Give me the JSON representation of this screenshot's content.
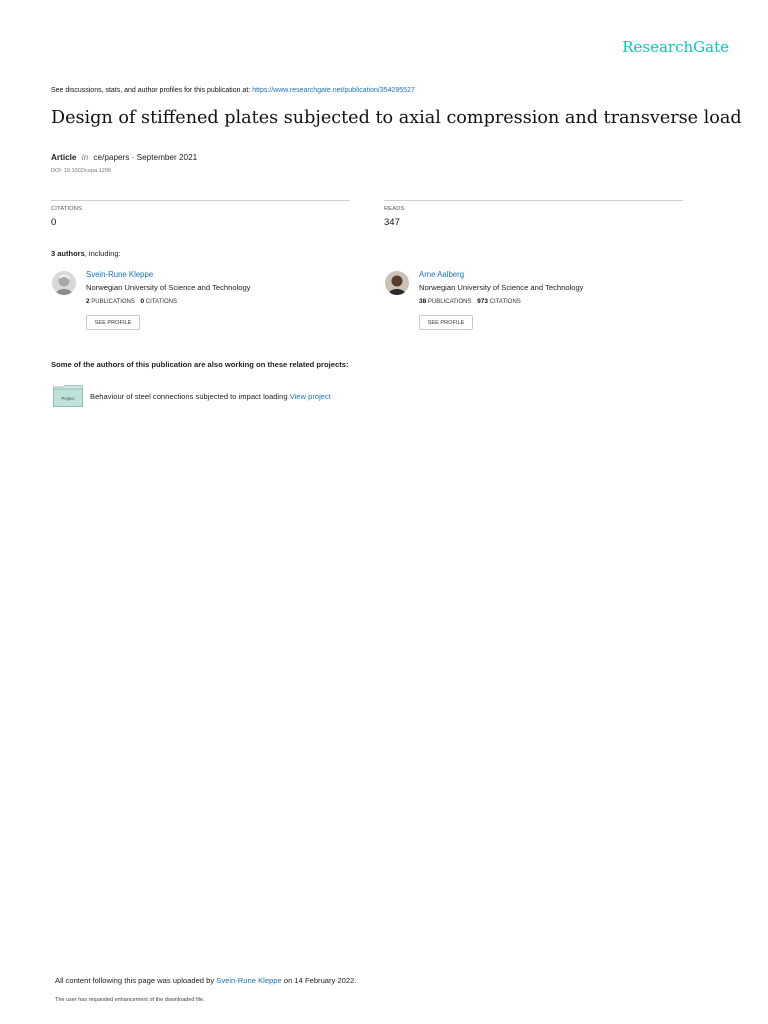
{
  "brand": {
    "name": "ResearchGate",
    "color": "#00ccbb"
  },
  "discussion": {
    "prefix": "See discussions, stats, and author profiles for this publication at:",
    "url": "https://www.researchgate.net/publication/354295527"
  },
  "title": "Design of stiffened plates subjected to axial compression and transverse load",
  "meta": {
    "type": "Article",
    "in_word": "in",
    "venue": "ce/papers",
    "date": " · September 2021",
    "doi": "DOI: 10.1002/cepa.1299"
  },
  "stats": {
    "citations_label": "CITATIONS",
    "citations_value": "0",
    "reads_label": "READS",
    "reads_value": "347"
  },
  "authors_heading": {
    "count": "3 authors",
    "suffix": ", including:"
  },
  "authors": [
    {
      "name": "Svein-Rune Kleppe",
      "affiliation": "Norwegian University of Science and Technology",
      "publications": "2",
      "publications_label": "PUBLICATIONS",
      "citations": "0",
      "citations_label": "CITATIONS",
      "button": "SEE PROFILE"
    },
    {
      "name": "Arne Aalberg",
      "affiliation": "Norwegian University of Science and Technology",
      "publications": "38",
      "publications_label": "PUBLICATIONS",
      "citations": "973",
      "citations_label": "CITATIONS",
      "button": "SEE PROFILE"
    }
  ],
  "related": {
    "heading": "Some of the authors of this publication are also working on these related projects:",
    "project_icon_label": "Project",
    "project_title": "Behaviour of steel connections subjected to impact loading",
    "project_link": "View project"
  },
  "footer": {
    "upload_prefix": "All content following this page was uploaded by",
    "uploader": "Svein-Rune Kleppe",
    "upload_suffix": "on 14 February 2022.",
    "note": "The user has requested enhancement of the downloaded file."
  }
}
